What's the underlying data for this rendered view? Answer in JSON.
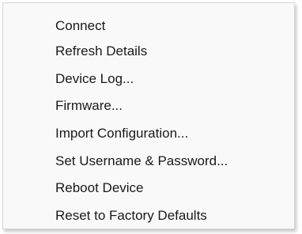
{
  "context_menu": {
    "items": [
      {
        "label": "Connect"
      },
      {
        "label": "Refresh Details"
      },
      {
        "label": "Device Log..."
      },
      {
        "label": "Firmware..."
      },
      {
        "label": "Import Configuration..."
      },
      {
        "label": "Set Username & Password..."
      },
      {
        "label": "Reboot Device"
      },
      {
        "label": "Reset to Factory Defaults"
      }
    ]
  }
}
